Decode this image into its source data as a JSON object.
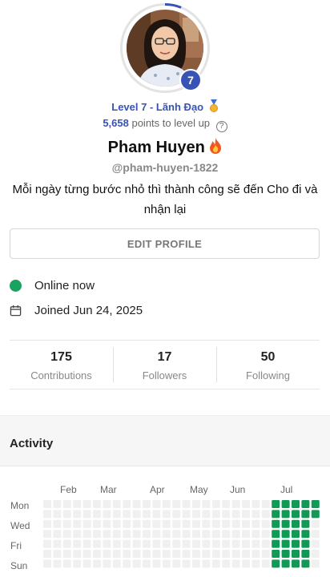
{
  "profile": {
    "level_badge": "7",
    "level_text": "Level 7 - Lãnh Đạo",
    "points_value": "5,658",
    "points_suffix": " points to level up",
    "name": "Pham Huyen",
    "handle": "@pham-huyen-1822",
    "bio": "Mỗi ngày từng bước nhỏ thì thành công sẽ đến Cho đi và nhận lại",
    "level_progress": 0.06
  },
  "edit_button": {
    "label": "EDIT PROFILE"
  },
  "status": {
    "online": "Online now",
    "joined": "Joined Jun 24, 2025"
  },
  "stats": [
    {
      "value": "175",
      "label": "Contributions"
    },
    {
      "value": "17",
      "label": "Followers"
    },
    {
      "value": "50",
      "label": "Following"
    }
  ],
  "activity": {
    "title": "Activity",
    "months": [
      "Feb",
      "Mar",
      "Apr",
      "May",
      "Jun",
      "Jul"
    ],
    "days": [
      "Mon",
      "Wed",
      "Fri",
      "Sun"
    ],
    "active_weeks": 5,
    "colors": {
      "empty": "#f0f0f0",
      "active": "#119a55"
    }
  },
  "colors": {
    "accent": "#3853b4",
    "online": "#1aa260"
  },
  "icons": {
    "level": "medal-icon",
    "name": "fire-icon",
    "joined": "calendar-icon",
    "help": "help-circle-icon"
  }
}
